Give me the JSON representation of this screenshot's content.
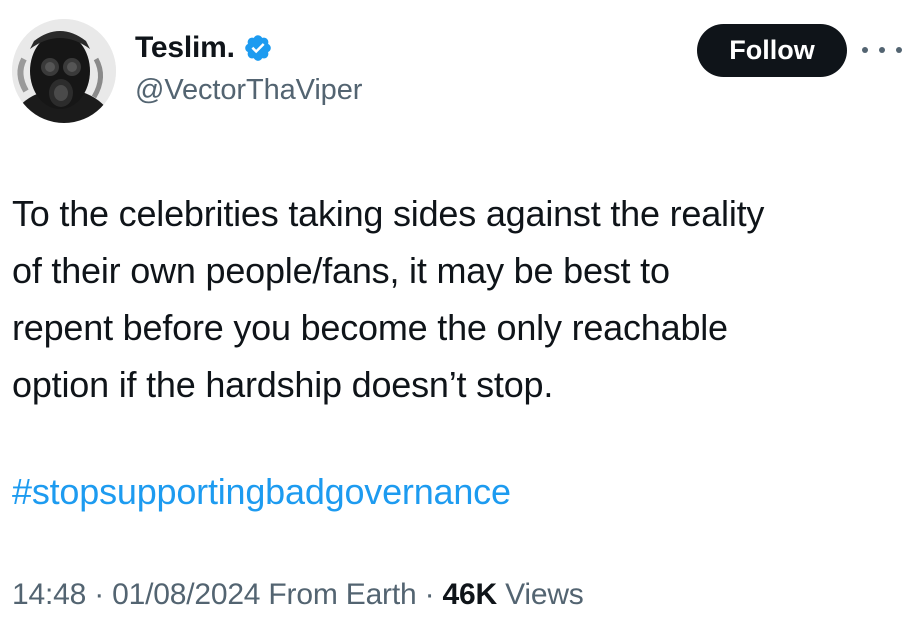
{
  "user": {
    "display_name": "Teslim.",
    "handle": "@VectorThaViper",
    "verified": true,
    "avatar_icon": "avatar-gas-mask"
  },
  "actions": {
    "follow_label": "Follow",
    "more_icon": "more-dots-icon"
  },
  "tweet": {
    "lines": [
      "To the celebrities taking sides against the reality",
      "of their own people/fans, it may be best to",
      "repent before you become the only reachable",
      "option if the hardship doesn’t stop."
    ],
    "hashtag": "#stopsupportingbadgovernance"
  },
  "meta": {
    "time": "14:48",
    "sep1": " · ",
    "date": "01/08/2024",
    "location": " From Earth",
    "sep2": " · ",
    "views_count": "46K",
    "views_label": " Views"
  },
  "colors": {
    "text": "#0f1419",
    "secondary": "#536471",
    "link": "#1d9bf0",
    "verified": "#1d9bf0",
    "follow_bg": "#0f1419"
  }
}
